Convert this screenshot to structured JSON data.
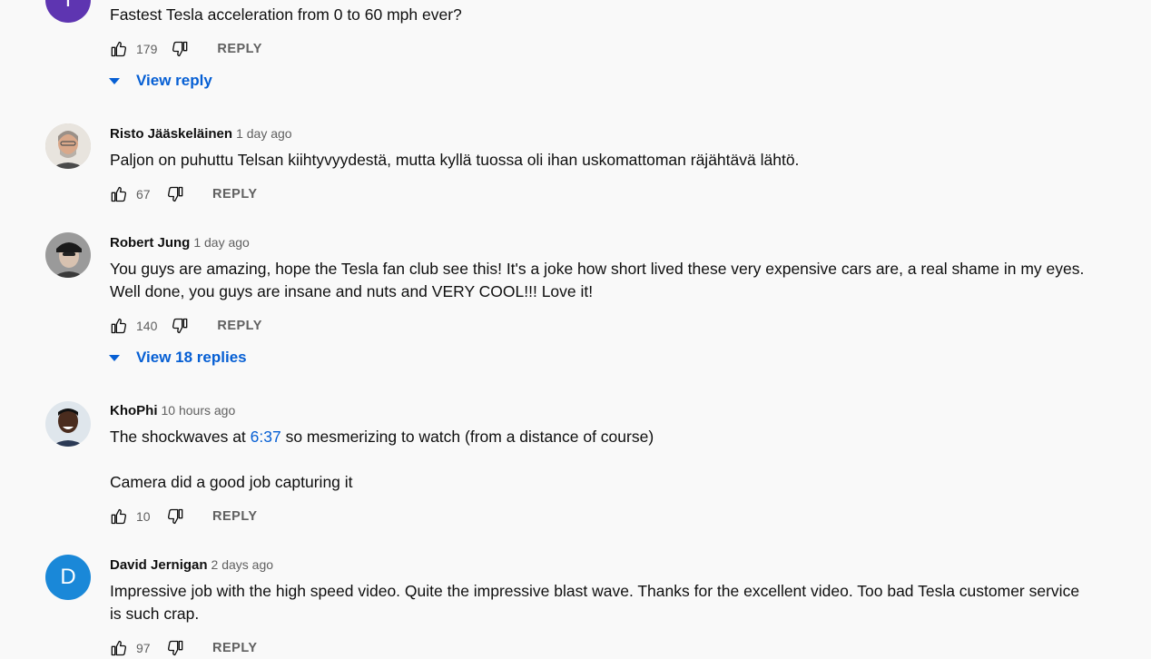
{
  "comments": [
    {
      "avatar_letter": "T",
      "avatar_color": "#5e35b1",
      "text": "Fastest Tesla acceleration from 0 to 60 mph ever?",
      "likes": "179",
      "reply_label": "REPLY",
      "view_replies": "View reply"
    },
    {
      "author": "Risto Jääskeläinen",
      "time": "1 day ago",
      "text": "Paljon on puhuttu Telsan kiihtyvyydestä, mutta kyllä tuossa oli ihan uskomattoman räjähtävä lähtö.",
      "likes": "67",
      "reply_label": "REPLY"
    },
    {
      "author": "Robert Jung",
      "time": "1 day ago",
      "text": "You guys are amazing, hope the Tesla fan club see this! It's a joke how short lived these very expensive cars are, a real shame in my eyes. Well done, you guys are insane and nuts and VERY COOL!!! Love it!",
      "likes": "140",
      "reply_label": "REPLY",
      "view_replies": "View 18 replies"
    },
    {
      "author": "KhoPhi",
      "time": "10 hours ago",
      "text_before": "The shockwaves at ",
      "timestamp_link": "6:37",
      "text_after": " so mesmerizing to watch (from a distance of course)",
      "text2": "Camera did a good job capturing it",
      "likes": "10",
      "reply_label": "REPLY"
    },
    {
      "author": "David Jernigan",
      "time": "2 days ago",
      "avatar_letter": "D",
      "avatar_color": "#1a88d8",
      "text": "Impressive job with the high speed video. Quite the impressive blast wave. Thanks for the excellent video. Too bad Tesla customer service is such crap.",
      "likes": "97",
      "reply_label": "REPLY"
    }
  ],
  "icons": {
    "like": "thumbs-up-icon",
    "dislike": "thumbs-down-icon",
    "expand": "caret-down-icon"
  },
  "colors": {
    "link": "#065fd4",
    "secondary_text": "#606060",
    "background": "#f9f9f9"
  }
}
